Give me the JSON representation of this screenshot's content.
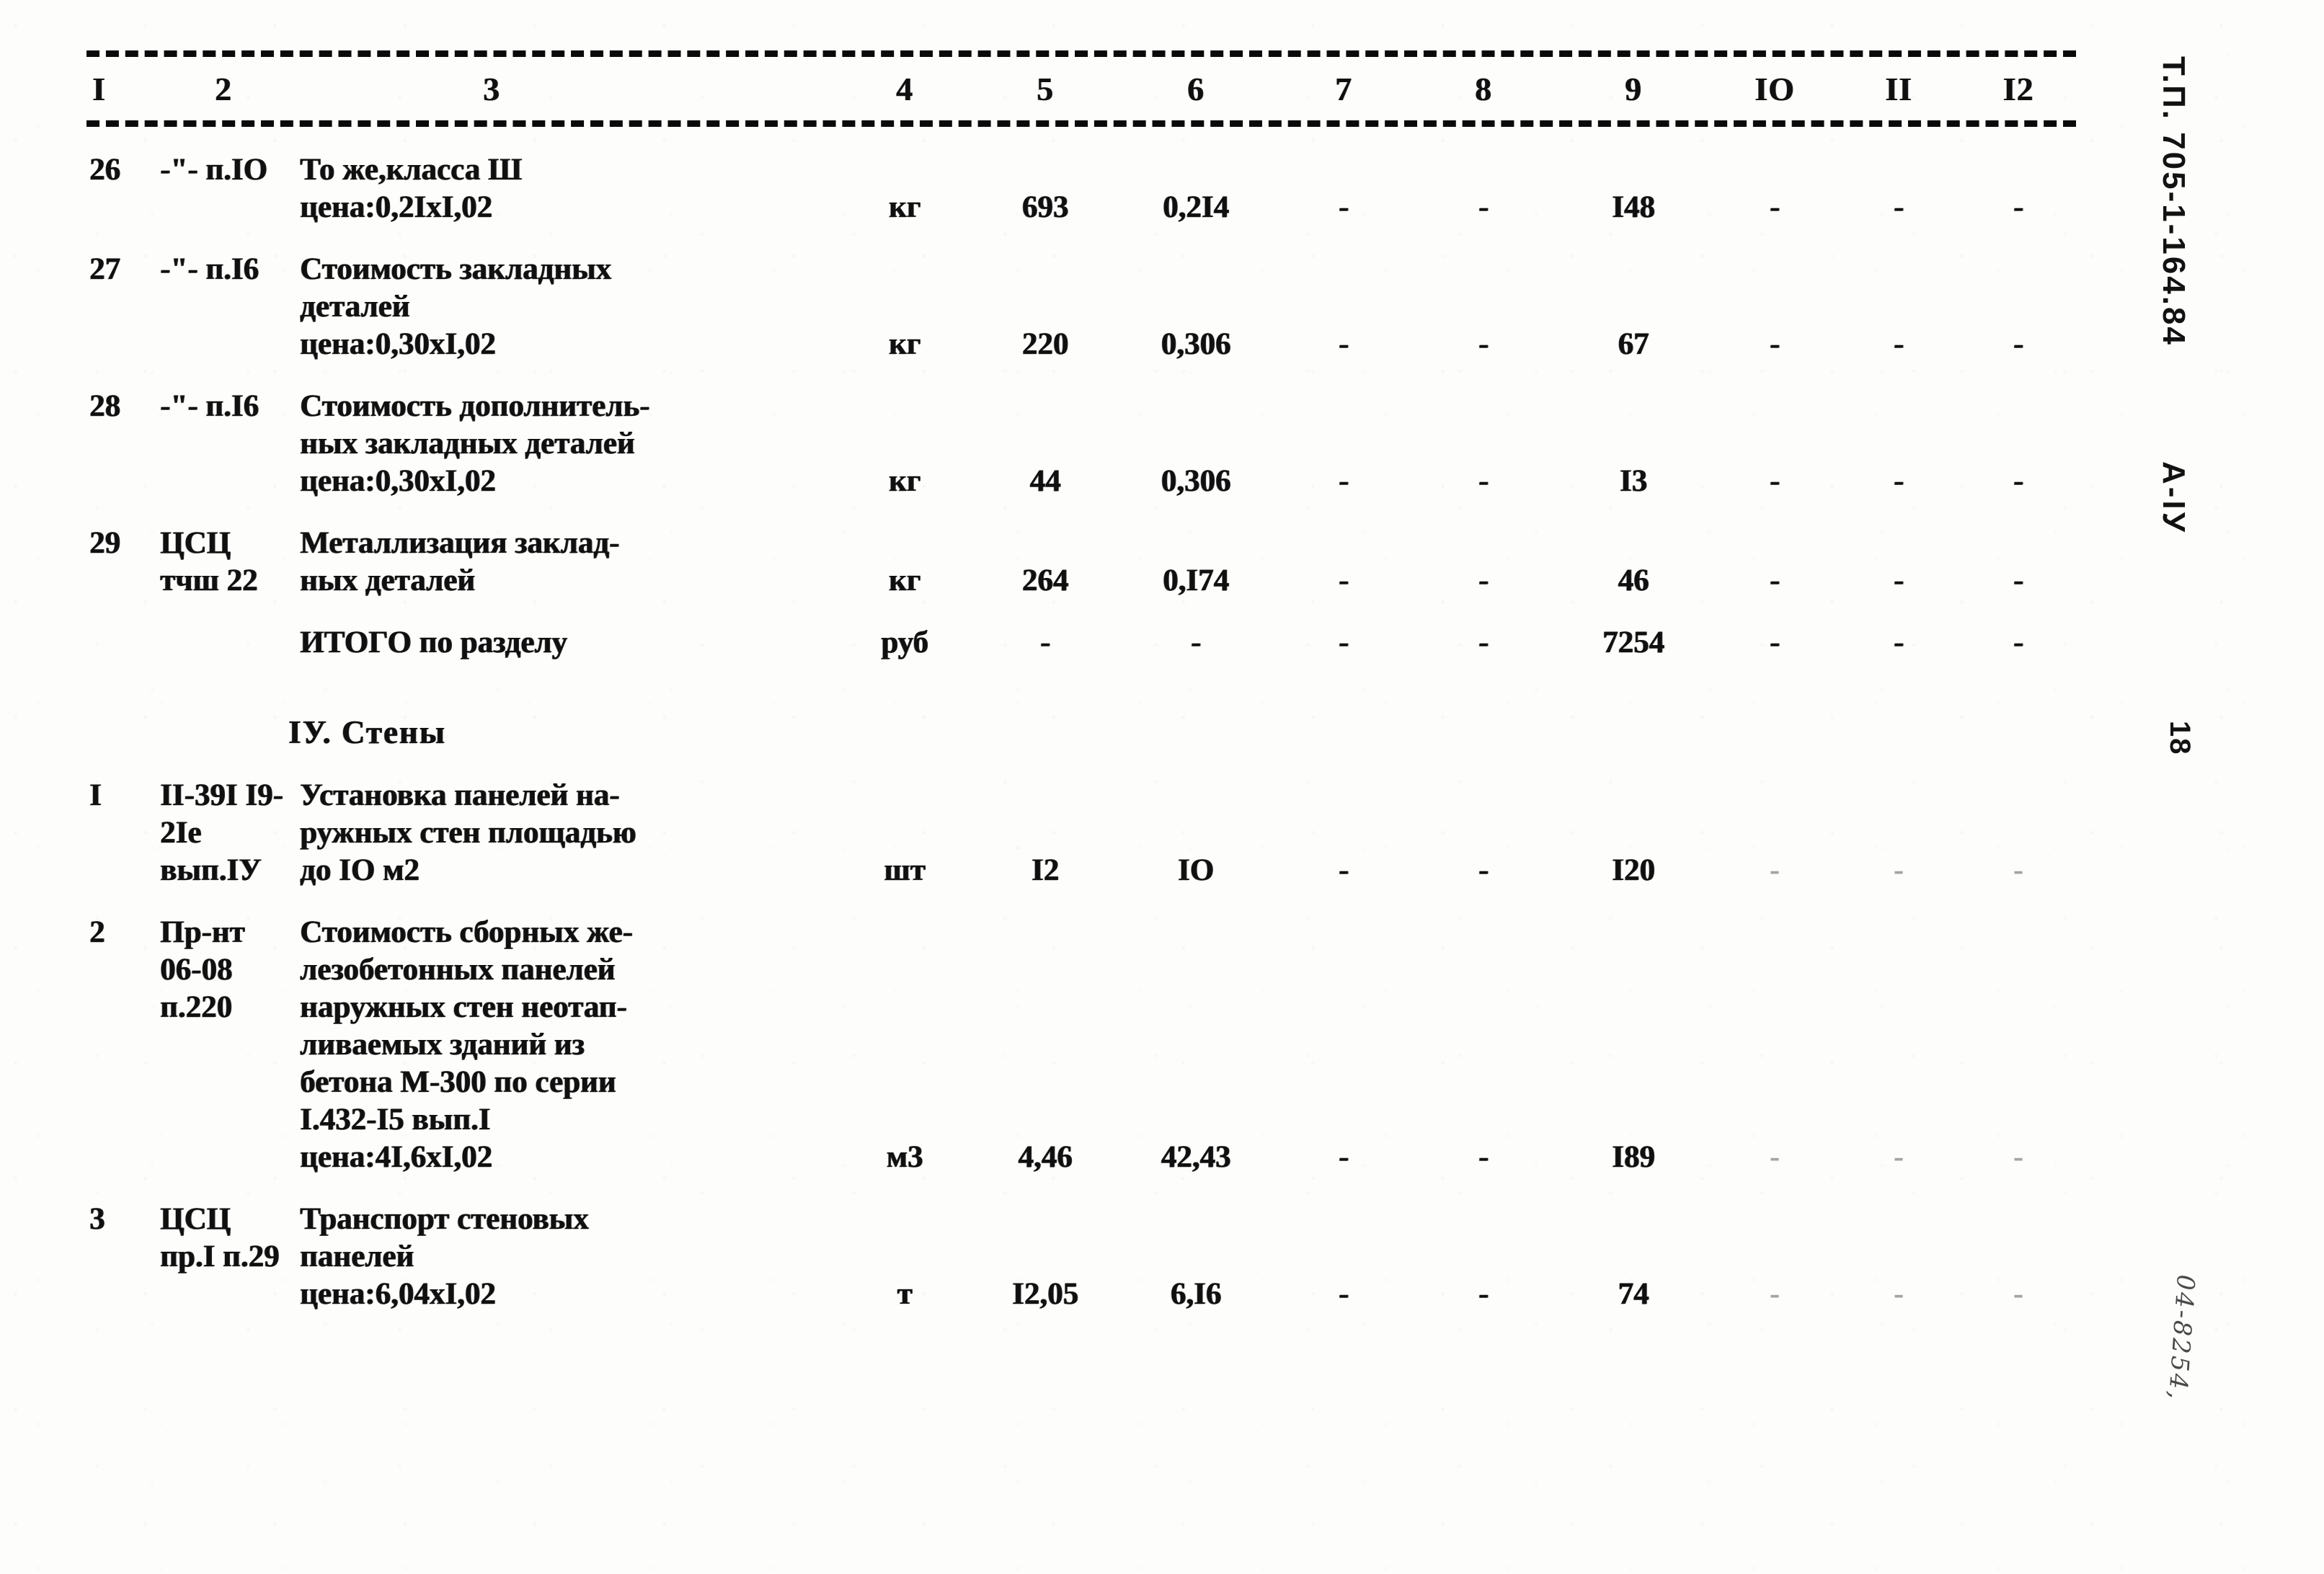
{
  "document": {
    "stamp_doc": "Т.П. 705-1-164.84",
    "stamp_album": "А-IУ",
    "stamp_page": "18",
    "handwritten_note": "04-8254,"
  },
  "table": {
    "column_headers": [
      "I",
      "2",
      "3",
      "4",
      "5",
      "6",
      "7",
      "8",
      "9",
      "IO",
      "II",
      "I2"
    ],
    "rows": [
      {
        "type": "item",
        "num": "26",
        "code": "-\"-\nп.IO",
        "desc": "То же,класса Ш\nцена:0,2IхI,02",
        "unit": "кг",
        "c5": "693",
        "c6": "0,2I4",
        "c7": "-",
        "c8": "-",
        "c9": "I48",
        "c10": "-",
        "c11": "-",
        "c12": "-",
        "faint_tail": false
      },
      {
        "type": "item",
        "num": "27",
        "code": "-\"-\nп.I6",
        "desc": "Стоимость закладных\nдеталей\nцена:0,30хI,02",
        "unit": "кг",
        "c5": "220",
        "c6": "0,306",
        "c7": "-",
        "c8": "-",
        "c9": "67",
        "c10": "-",
        "c11": "-",
        "c12": "-",
        "faint_tail": false
      },
      {
        "type": "item",
        "num": "28",
        "code": "-\"-\nп.I6",
        "desc": "Стоимость дополнитель-\nных закладных деталей\nцена:0,30хI,02",
        "unit": "кг",
        "c5": "44",
        "c6": "0,306",
        "c7": "-",
        "c8": "-",
        "c9": "I3",
        "c10": "-",
        "c11": "-",
        "c12": "-",
        "faint_tail": false
      },
      {
        "type": "item",
        "num": "29",
        "code": "ЦСЦ\nтчш 22",
        "desc": "Металлизация заклад-\nных деталей",
        "unit": "кг",
        "c5": "264",
        "c6": "0,I74",
        "c7": "-",
        "c8": "-",
        "c9": "46",
        "c10": "-",
        "c11": "-",
        "c12": "-",
        "faint_tail": false
      },
      {
        "type": "total",
        "num": "",
        "code": "",
        "desc": "ИТОГО по разделу",
        "unit": "руб",
        "c5": "-",
        "c6": "-",
        "c7": "-",
        "c8": "-",
        "c9": "7254",
        "c10": "-",
        "c11": "-",
        "c12": "-",
        "faint_tail": false
      },
      {
        "type": "section",
        "title": "IУ. Стены"
      },
      {
        "type": "item",
        "num": "I",
        "code": "II-39I\nI9-2Iе\nвып.IУ",
        "desc": "Установка панелей на-\nружных стен площадью\nдо IО м2",
        "unit": "шт",
        "c5": "I2",
        "c6": "IО",
        "c7": "-",
        "c8": "-",
        "c9": "I20",
        "c10": "-",
        "c11": "-",
        "c12": "-",
        "faint_tail": true
      },
      {
        "type": "item",
        "num": "2",
        "code": "Пр-нт\n06-08\nп.220",
        "desc": "Стоимость сборных же-\nлезобетонных панелей\nнаружных стен неотап-\nливаемых зданий из\nбетона М-300 по серии\nI.432-I5 вып.I\nцена:4I,6хI,02",
        "unit": "м3",
        "c5": "4,46",
        "c6": "42,43",
        "c7": "-",
        "c8": "-",
        "c9": "I89",
        "c10": "-",
        "c11": "-",
        "c12": "-",
        "faint_tail": true
      },
      {
        "type": "item",
        "num": "3",
        "code": "ЦСЦ\nпр.I\nп.29",
        "desc": "Транспорт стеновых\nпанелей\nцена:6,04хI,02",
        "unit": "т",
        "c5": "I2,05",
        "c6": "6,I6",
        "c7": "-",
        "c8": "-",
        "c9": "74",
        "c10": "-",
        "c11": "-",
        "c12": "-",
        "faint_tail": true
      }
    ]
  }
}
